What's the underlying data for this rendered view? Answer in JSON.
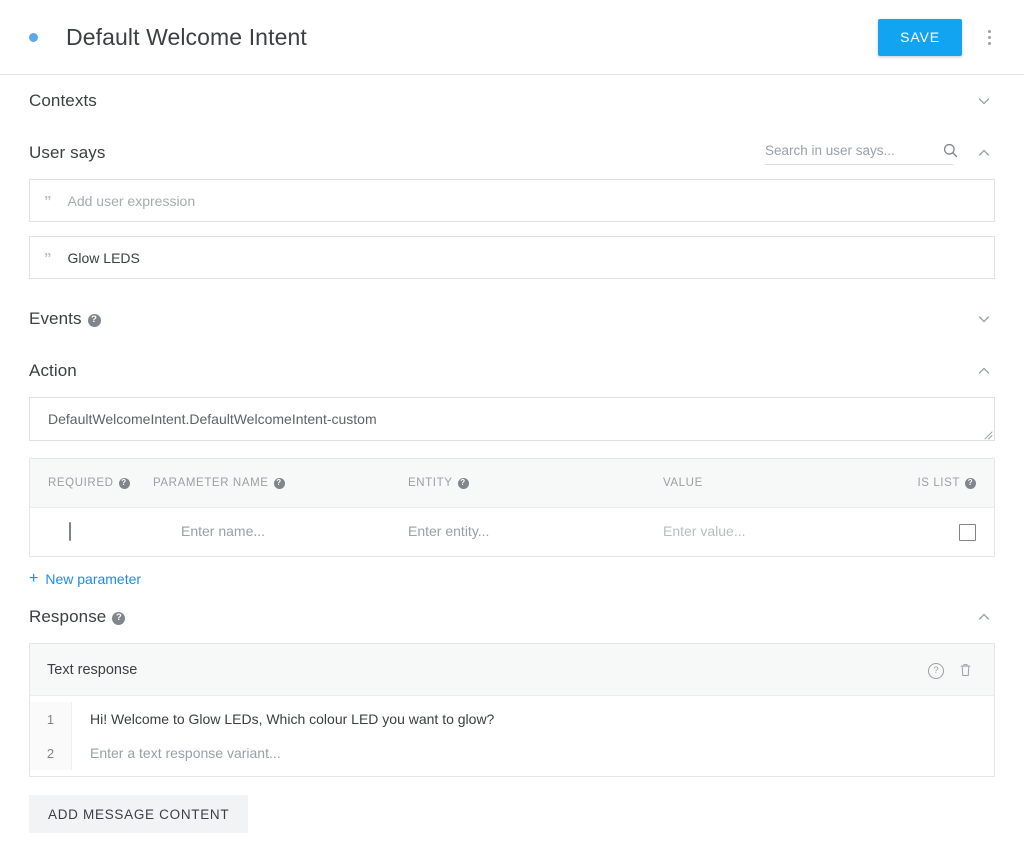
{
  "header": {
    "title": "Default Welcome Intent",
    "status_dot_color": "#5aa8e8",
    "save_label": "SAVE",
    "accent_color": "#12a4f0"
  },
  "sections": {
    "contexts": {
      "title": "Contexts",
      "collapsed": true
    },
    "user_says": {
      "title": "User says",
      "search_placeholder": "Search in user says...",
      "search_value": "",
      "expressions": [
        {
          "text": "Add user expression",
          "is_placeholder": true
        },
        {
          "text": "Glow LEDS",
          "is_placeholder": false
        }
      ]
    },
    "events": {
      "title": "Events",
      "collapsed": true
    },
    "action": {
      "title": "Action",
      "value": "DefaultWelcomeIntent.DefaultWelcomeIntent-custom",
      "table": {
        "columns": [
          {
            "label": "REQUIRED",
            "help": true
          },
          {
            "label": "PARAMETER NAME",
            "help": true
          },
          {
            "label": "ENTITY",
            "help": true
          },
          {
            "label": "VALUE",
            "help": false
          },
          {
            "label": "IS LIST",
            "help": true
          }
        ],
        "rows": [
          {
            "required_checked": false,
            "name_placeholder": "Enter name...",
            "entity_placeholder": "Enter entity...",
            "value_placeholder": "Enter value...",
            "is_list_checked": false
          }
        ]
      },
      "new_parameter_label": "New parameter",
      "new_parameter_color": "#1a8cf0"
    },
    "response": {
      "title": "Response",
      "card_title": "Text response",
      "lines": [
        {
          "number": "1",
          "text": "Hi! Welcome to Glow LEDs, Which colour LED you want to glow?",
          "is_placeholder": false
        },
        {
          "number": "2",
          "text": "Enter a text response variant...",
          "is_placeholder": true
        }
      ],
      "add_message_label": "ADD MESSAGE CONTENT"
    }
  },
  "icons": {
    "help": "?",
    "quote": "”",
    "plus": "+",
    "search": "search-icon",
    "trash": "trash-icon",
    "kebab": "more-vert-icon"
  }
}
